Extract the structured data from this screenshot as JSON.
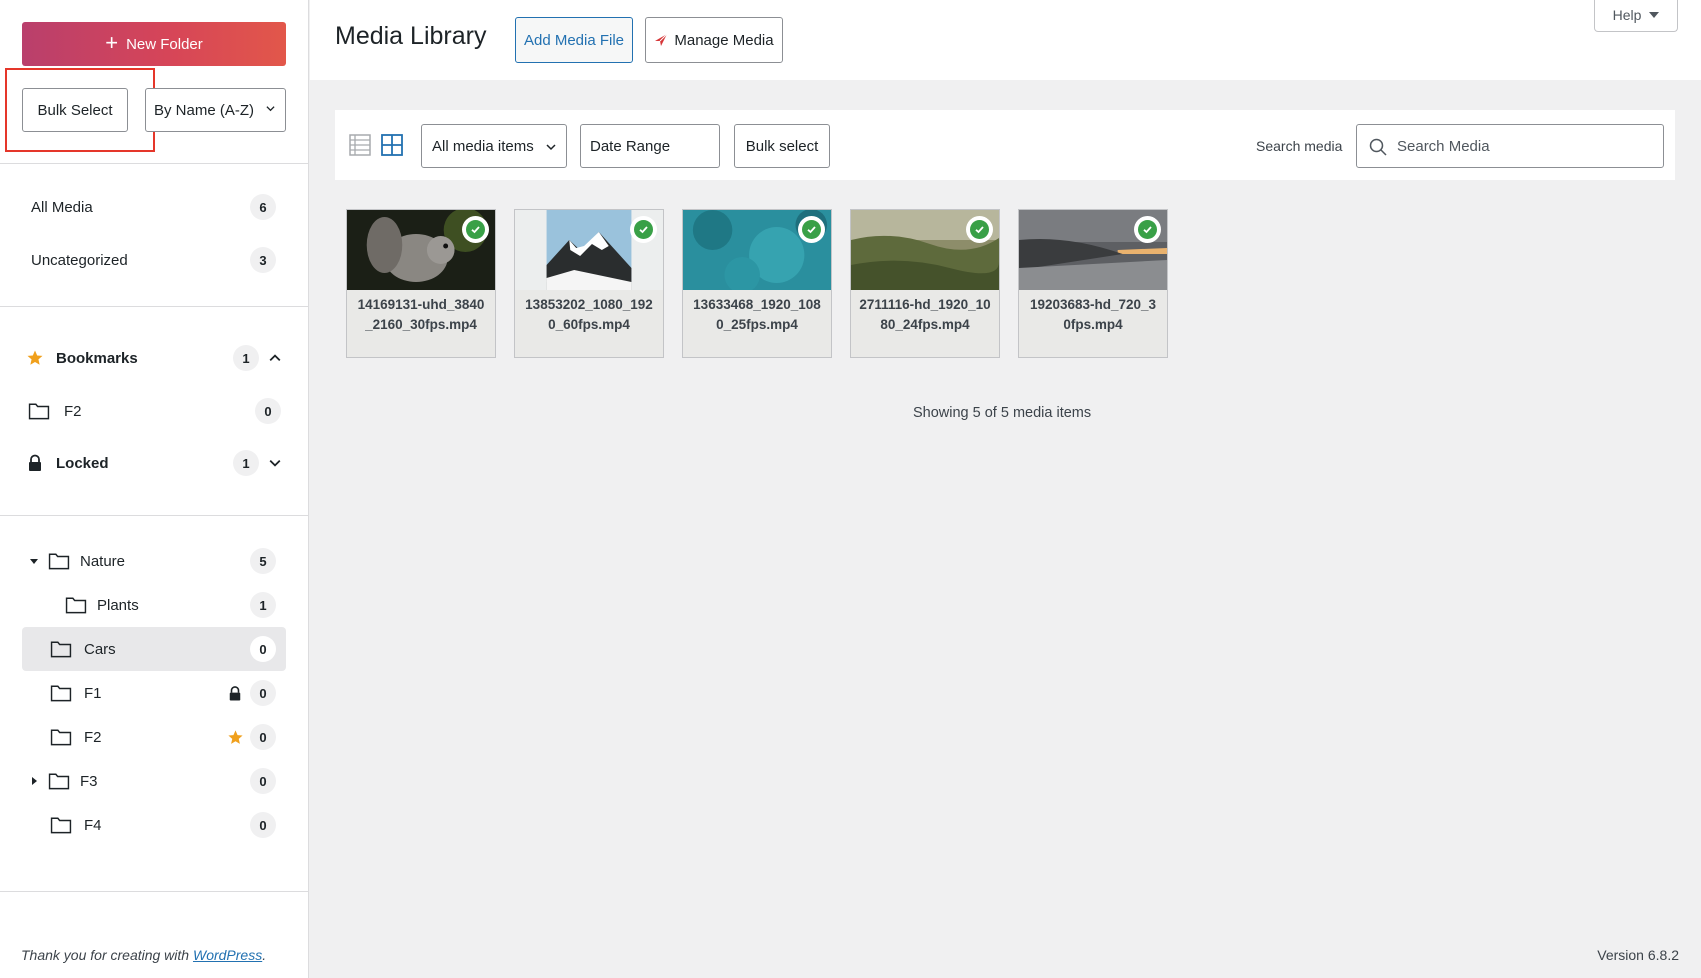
{
  "sidebar": {
    "new_folder_label": "New Folder",
    "bulk_select_label": "Bulk Select",
    "sort_value": "By Name (A-Z)",
    "main_items": [
      {
        "label": "All Media",
        "count": "6"
      },
      {
        "label": "Uncategorized",
        "count": "3"
      }
    ],
    "bookmarks": {
      "label": "Bookmarks",
      "count": "1"
    },
    "bookmark_items": [
      {
        "label": "F2",
        "count": "0"
      }
    ],
    "locked": {
      "label": "Locked",
      "count": "1"
    },
    "folders": [
      {
        "label": "Nature",
        "count": "5"
      },
      {
        "label": "Plants",
        "count": "1"
      },
      {
        "label": "Cars",
        "count": "0"
      },
      {
        "label": "F1",
        "count": "0"
      },
      {
        "label": "F2",
        "count": "0"
      },
      {
        "label": "F3",
        "count": "0"
      },
      {
        "label": "F4",
        "count": "0"
      }
    ]
  },
  "header": {
    "title": "Media Library",
    "add_media_label": "Add Media File",
    "manage_media_label": "Manage Media",
    "help_label": "Help"
  },
  "toolbar": {
    "filter_value": "All media items",
    "date_range_label": "Date Range",
    "bulk_select_label": "Bulk select",
    "search_label": "Search media",
    "search_placeholder": "Search Media"
  },
  "media": [
    {
      "name": "14169131-uhd_3840_2160_30fps.mp4"
    },
    {
      "name": "13853202_1080_1920_60fps.mp4"
    },
    {
      "name": "13633468_1920_1080_25fps.mp4"
    },
    {
      "name": "2711116-hd_1920_1080_24fps.mp4"
    },
    {
      "name": "19203683-hd_720_30fps.mp4"
    }
  ],
  "showing_text": "Showing 5 of 5 media items",
  "footer": {
    "thanks_prefix": "Thank you for creating with ",
    "thanks_link": "WordPress",
    "thanks_suffix": ".",
    "version": "Version 6.8.2"
  },
  "colors": {
    "accent": "#2271b1",
    "new_folder_gradient_start": "#b93f6c",
    "new_folder_gradient_end": "#e2574a",
    "check_green": "#39a047",
    "star_orange": "#f0a01c",
    "highlight_red": "#e5362a"
  }
}
